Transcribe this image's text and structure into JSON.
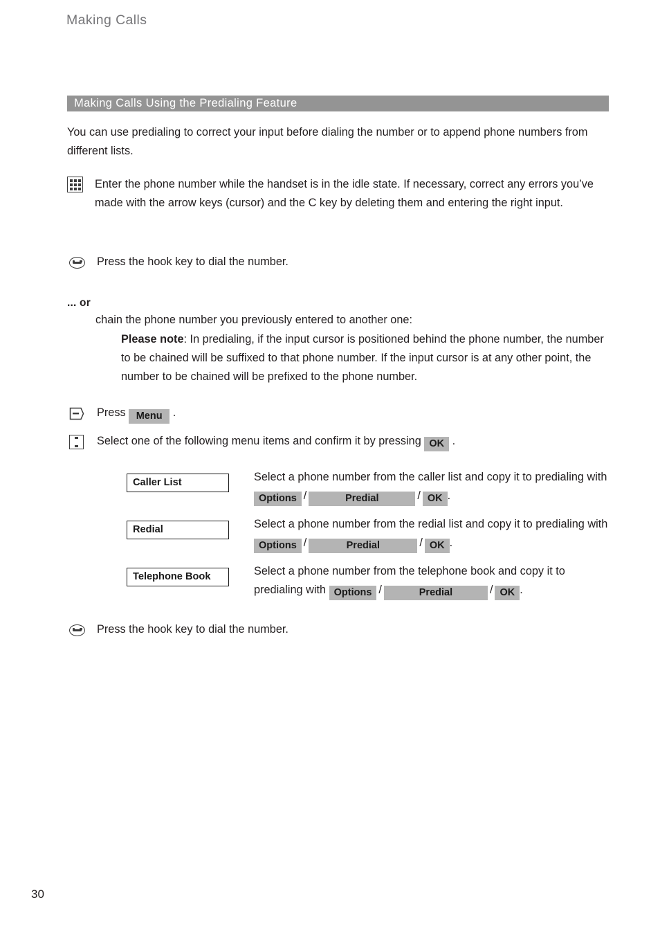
{
  "header": {
    "running_title": "Making Calls"
  },
  "section": {
    "title": "Making Calls Using the Predialing Feature"
  },
  "intro": {
    "text": "You can use predialing to correct your input before dialing the number or to append phone numbers from different lists."
  },
  "steps": {
    "keypad": {
      "icon": "keypad-icon",
      "text": "Enter the phone number while the handset is in the idle state. If necessary, correct any errors you’ve made with the arrow keys (cursor) and the C key by deleting them and entering the right input."
    },
    "hook_first": {
      "icon": "hook-key-icon",
      "text": "Press the hook key to dial the number."
    },
    "hook_last": {
      "icon": "hook-key-icon",
      "text": "Press the hook key to dial the number."
    },
    "menu": {
      "icon": "soft-key-icon",
      "press_label": "Press",
      "key_label": "Menu",
      "period": "."
    },
    "select": {
      "icon": "navigation-key-icon",
      "text_before": "Select one of the following menu items and confirm it by pressing",
      "key_label": "OK",
      "period": "."
    }
  },
  "alternative": {
    "or_label": "... or",
    "chain_line": "chain the phone number you previously entered to another one:",
    "note_label": "Please note",
    "note_text": ": In predialing, if the input cursor is positioned behind the phone number, the number to be chained will be suffixed to that phone number. If the input cursor is at any other point, the number to be chained will be prefixed to the phone number."
  },
  "menu_items": [
    {
      "box_label": "Caller List",
      "desc_before": "Select a phone number from the caller list and copy it to predialing with",
      "key_options": "Options",
      "key_predial": "Predial",
      "key_ok": "OK",
      "separator": "/",
      "period": "."
    },
    {
      "box_label": "Redial",
      "desc_before": "Select a phone number from the redial list and copy it to predialing with",
      "key_options": "Options",
      "key_predial": "Predial",
      "key_ok": "OK",
      "separator": "/",
      "period": "."
    },
    {
      "box_label": "Telephone Book",
      "desc_before": "Select a phone number from the telephone book and copy it to predialing with",
      "key_options": "Options",
      "key_predial": "Predial",
      "key_ok": "OK",
      "separator": "/",
      "period": "."
    }
  ],
  "footer": {
    "page_number": "30"
  },
  "colors": {
    "section_bar_bg": "#949494",
    "section_bar_text": "#ffffff",
    "key_pill_bg": "#b4b4b4",
    "body_text": "#231f20",
    "running_header_text": "#77777a"
  }
}
